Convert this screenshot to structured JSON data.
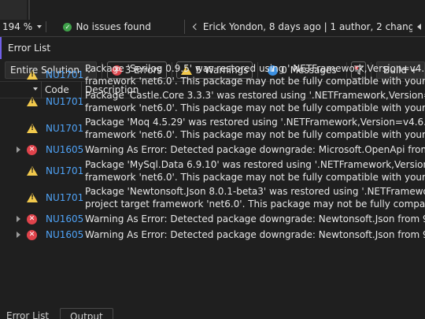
{
  "statusbar": {
    "zoom": "194 %",
    "issues": "No issues found",
    "blame": "Erick Yondon, 8 days ago | 1 author, 2 changes"
  },
  "panel": {
    "title": "Error List"
  },
  "toolbar": {
    "scope": "Entire Solution",
    "errors": "3 Errors",
    "warnings": "5 Warnings",
    "messages": "0 Messages",
    "build": "Build +"
  },
  "table": {
    "columns": {
      "code": "Code",
      "description": "Description"
    },
    "rows": [
      {
        "severity": "warning",
        "code": "NU1701",
        "line1": "Package 'Serilog 0.9.5' was restored using '.NETFramework,Version=v4.6.1, .NETFram",
        "line2": "framework 'net6.0'. This package may not be fully compatible with your project."
      },
      {
        "severity": "warning",
        "code": "NU1701",
        "line1": "Package 'Castle.Core 3.3.3' was restored using '.NETFramework,Version=v4.6.1, .NE",
        "line2": "framework 'net6.0'. This package may not be fully compatible with your project."
      },
      {
        "severity": "warning",
        "code": "NU1701",
        "line1": "Package 'Moq 4.5.29' was restored using '.NETFramework,Version=v4.6.1, .NETFrame",
        "line2": "framework 'net6.0'. This package may not be fully compatible with your project."
      },
      {
        "severity": "error",
        "code": "NU1605",
        "line1": "Warning As Error: Detected package downgrade: Microsoft.OpenApi from 1.1.4 to",
        "line2": ""
      },
      {
        "severity": "warning",
        "code": "NU1701",
        "line1": "Package 'MySql.Data 6.9.10' was restored using '.NETFramework,Version=v4.6.1, .NE",
        "line2": "framework 'net6.0'. This package may not be fully compatible with your project."
      },
      {
        "severity": "warning",
        "code": "NU1701",
        "line1": "Package 'Newtonsoft.Json 8.0.1-beta3' was restored using '.NETFramework,Version",
        "line2": "project target framework 'net6.0'. This package may not be fully compatible with yo"
      },
      {
        "severity": "error",
        "code": "NU1605",
        "line1": "Warning As Error: Detected package downgrade: Newtonsoft.Json from 9.0.1 to 8.0",
        "line2": ""
      },
      {
        "severity": "error",
        "code": "NU1605",
        "line1": "Warning As Error: Detected package downgrade: Newtonsoft.Json from 9.0.1 to 8.0",
        "line2": ""
      }
    ]
  },
  "bottom_tabs": {
    "error_list": "Error List",
    "output": "Output"
  },
  "colors": {
    "accent": "#7160e8",
    "error": "#e0434b",
    "warning": "#f2c94c",
    "info": "#3b8fe0",
    "ok": "#3fa14a",
    "link": "#4fa3f7"
  }
}
